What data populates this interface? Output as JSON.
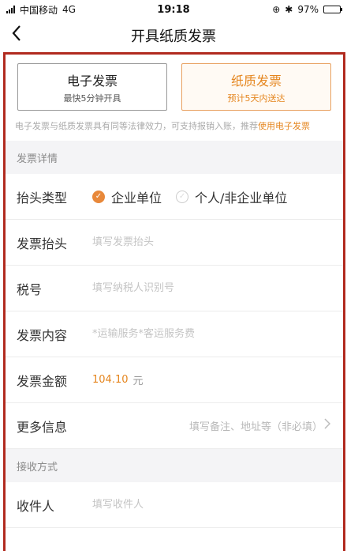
{
  "status_bar": {
    "carrier": "中国移动",
    "network": "4G",
    "time": "19:18",
    "battery": "97%",
    "battery_level": 0.97
  },
  "nav": {
    "back_icon": "chevron-left-icon",
    "title": "开具纸质发票"
  },
  "invoice_types": [
    {
      "title": "电子发票",
      "sub": "最快5分钟开具",
      "selected": false
    },
    {
      "title": "纸质发票",
      "sub": "预计5天内送达",
      "selected": true
    }
  ],
  "note": {
    "text": "电子发票与纸质发票具有同等法律效力，可支持报销入账，推荐",
    "link": "使用电子发票"
  },
  "details": {
    "header": "发票详情",
    "title_type": {
      "label": "抬头类型",
      "options": [
        "企业单位",
        "个人/非企业单位"
      ],
      "selected_index": 0
    },
    "invoice_title": {
      "label": "发票抬头",
      "placeholder": "填写发票抬头"
    },
    "tax_id": {
      "label": "税号",
      "placeholder": "填写纳税人识别号"
    },
    "content": {
      "label": "发票内容",
      "placeholder": "*运输服务*客运服务费"
    },
    "amount": {
      "label": "发票金额",
      "value": "104.10",
      "unit": "元"
    },
    "more": {
      "label": "更多信息",
      "placeholder": "填写备注、地址等（非必填）"
    }
  },
  "receive": {
    "header": "接收方式",
    "recipient": {
      "label": "收件人",
      "placeholder": "填写收件人"
    }
  },
  "colors": {
    "accent": "#e5861f",
    "frame_border": "#b12a1f"
  }
}
